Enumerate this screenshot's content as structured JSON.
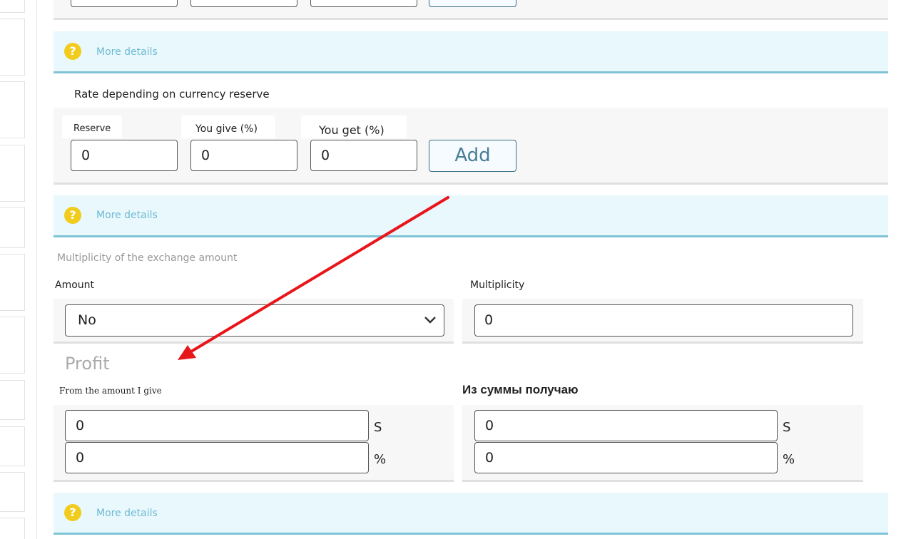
{
  "rate_section": {
    "title": "Rate depending on currency reserve",
    "reserve_label": "Reserve",
    "give_label": "You give (%)",
    "get_label": "You get (%)",
    "reserve_value": "0",
    "give_value": "0",
    "get_value": "0",
    "add_label": "Add"
  },
  "info_bars": [
    {
      "link": "More details",
      "icon": "question-icon"
    },
    {
      "link": "More details",
      "icon": "question-icon"
    },
    {
      "link": "More details",
      "icon": "question-icon"
    }
  ],
  "multiplicity_section": {
    "title": "Multiplicity of the exchange amount",
    "amount_label": "Amount",
    "amount_selected": "No",
    "multiplicity_label": "Multiplicity",
    "multiplicity_value": "0"
  },
  "profit_section": {
    "title": "Profit",
    "give_label": "From the amount I give",
    "get_label": "Из суммы получаю",
    "give_sum": "0",
    "give_percent": "0",
    "get_sum": "0",
    "get_percent": "0",
    "unit_sum": "S",
    "unit_percent": "%"
  },
  "colors": {
    "info_bg": "#e9f8fd",
    "info_border": "#7fc3d6",
    "link": "#6fbad2",
    "question_icon": "#f2cc1d",
    "arrow": "#e8151b"
  }
}
